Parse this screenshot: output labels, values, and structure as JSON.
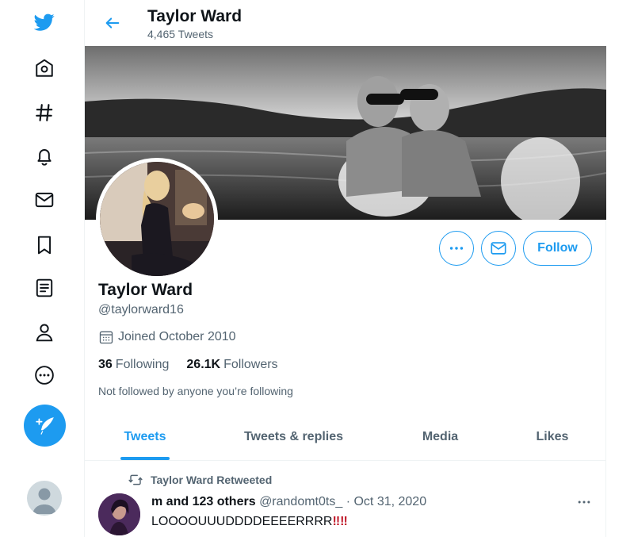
{
  "nav": {
    "icons": [
      "twitter-bird-icon",
      "home-icon",
      "hashtag-icon",
      "bell-icon",
      "mail-icon",
      "bookmark-icon",
      "list-icon",
      "person-icon",
      "more-circle-icon",
      "compose-icon"
    ]
  },
  "header": {
    "name": "Taylor Ward",
    "tweet_count": "4,465 Tweets"
  },
  "profile": {
    "name": "Taylor Ward",
    "handle": "@taylorward16",
    "joined": "Joined October 2010",
    "following_count": "36",
    "following_label": "Following",
    "followers_count": "26.1K",
    "followers_label": "Followers",
    "not_followed": "Not followed by anyone you’re following",
    "follow_button": "Follow"
  },
  "tabs": [
    {
      "label": "Tweets",
      "active": true
    },
    {
      "label": "Tweets & replies",
      "active": false
    },
    {
      "label": "Media",
      "active": false
    },
    {
      "label": "Likes",
      "active": false
    }
  ],
  "tweet": {
    "retweet_label": "Taylor Ward Retweeted",
    "author": "m and 123 others",
    "handle": "@randomt0ts_",
    "separator": "·",
    "date": "Oct 31, 2020",
    "text": "LOOOOUUUDDDDEEEERRRR",
    "emoji": "‼‼"
  },
  "colors": {
    "accent": "#1d9bf0",
    "text_primary": "#0f1419",
    "text_secondary": "#536471",
    "border": "#eff3f4"
  }
}
